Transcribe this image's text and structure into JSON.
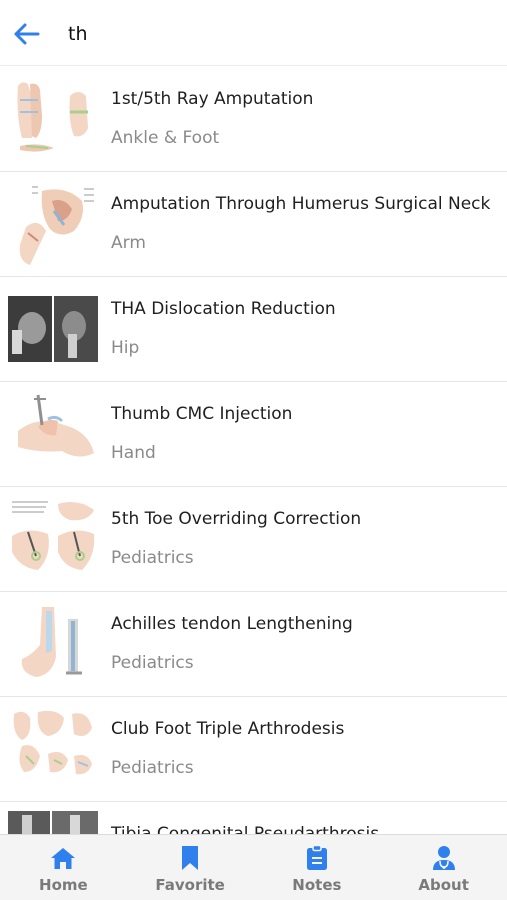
{
  "search": {
    "value": "th"
  },
  "results": [
    {
      "title": "1st/5th Ray Amputation",
      "category": "Ankle & Foot"
    },
    {
      "title": "Amputation Through Humerus Surgical Neck",
      "category": "Arm"
    },
    {
      "title": "THA Dislocation Reduction",
      "category": "Hip"
    },
    {
      "title": "Thumb CMC Injection",
      "category": "Hand"
    },
    {
      "title": "5th Toe Overriding Correction",
      "category": "Pediatrics"
    },
    {
      "title": "Achilles tendon Lengthening",
      "category": "Pediatrics"
    },
    {
      "title": "Club Foot Triple Arthrodesis",
      "category": "Pediatrics"
    },
    {
      "title": "Tibia Congenital Pseudarthrosis",
      "category": ""
    }
  ],
  "tabs": [
    {
      "label": "Home",
      "icon": "home-icon"
    },
    {
      "label": "Favorite",
      "icon": "bookmark-icon"
    },
    {
      "label": "Notes",
      "icon": "clipboard-icon"
    },
    {
      "label": "About",
      "icon": "doctor-icon"
    }
  ],
  "colors": {
    "accent": "#2f80ed",
    "tab_label": "#7a7a7a",
    "category_text": "#8a8a8a"
  }
}
